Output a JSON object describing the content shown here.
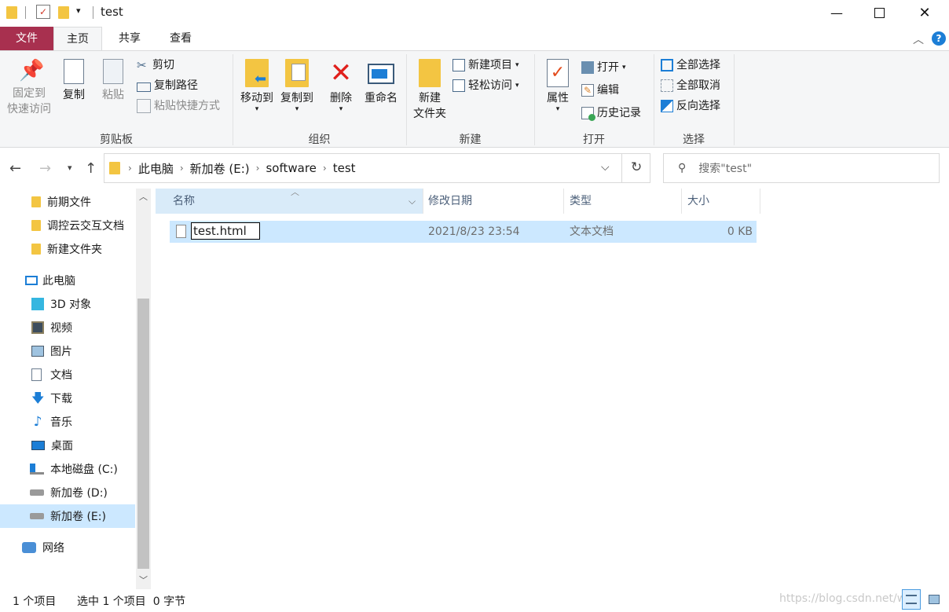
{
  "window": {
    "title": "test"
  },
  "tabs": [
    {
      "label": "文件"
    },
    {
      "label": "主页"
    },
    {
      "label": "共享"
    },
    {
      "label": "查看"
    }
  ],
  "ribbon": {
    "clipboard": {
      "label": "剪贴板",
      "pin": "固定到\n快速访问",
      "copy": "复制",
      "paste": "粘贴",
      "cut": "剪切",
      "copy_path": "复制路径",
      "paste_shortcut": "粘贴快捷方式"
    },
    "organize": {
      "label": "组织",
      "move_to": "移动到",
      "copy_to": "复制到",
      "delete": "删除",
      "rename": "重命名"
    },
    "new": {
      "label": "新建",
      "new_folder": "新建\n文件夹",
      "new_item": "新建项目",
      "easy_access": "轻松访问"
    },
    "open": {
      "label": "打开",
      "properties": "属性",
      "open": "打开",
      "edit": "编辑",
      "history": "历史记录"
    },
    "select": {
      "label": "选择",
      "select_all": "全部选择",
      "select_none": "全部取消",
      "invert": "反向选择"
    }
  },
  "address": {
    "crumbs": [
      "此电脑",
      "新加卷 (E:)",
      "software",
      "test"
    ]
  },
  "search": {
    "placeholder": "搜索\"test\""
  },
  "nav": {
    "quick": [
      "前期文件",
      "调控云交互文档",
      "新建文件夹"
    ],
    "this_pc": "此电脑",
    "pc_items": [
      "3D 对象",
      "视频",
      "图片",
      "文档",
      "下载",
      "音乐",
      "桌面",
      "本地磁盘 (C:)",
      "新加卷 (D:)",
      "新加卷 (E:)"
    ],
    "network": "网络"
  },
  "columns": {
    "name": "名称",
    "modified": "修改日期",
    "type": "类型",
    "size": "大小"
  },
  "files": [
    {
      "name": "test.html",
      "modified": "2021/8/23 23:54",
      "type": "文本文档",
      "size": "0 KB"
    }
  ],
  "status": {
    "count": "1 个项目",
    "selected": "选中 1 个项目  0 字节"
  },
  "watermark": "https://blog.csdn.net/w"
}
